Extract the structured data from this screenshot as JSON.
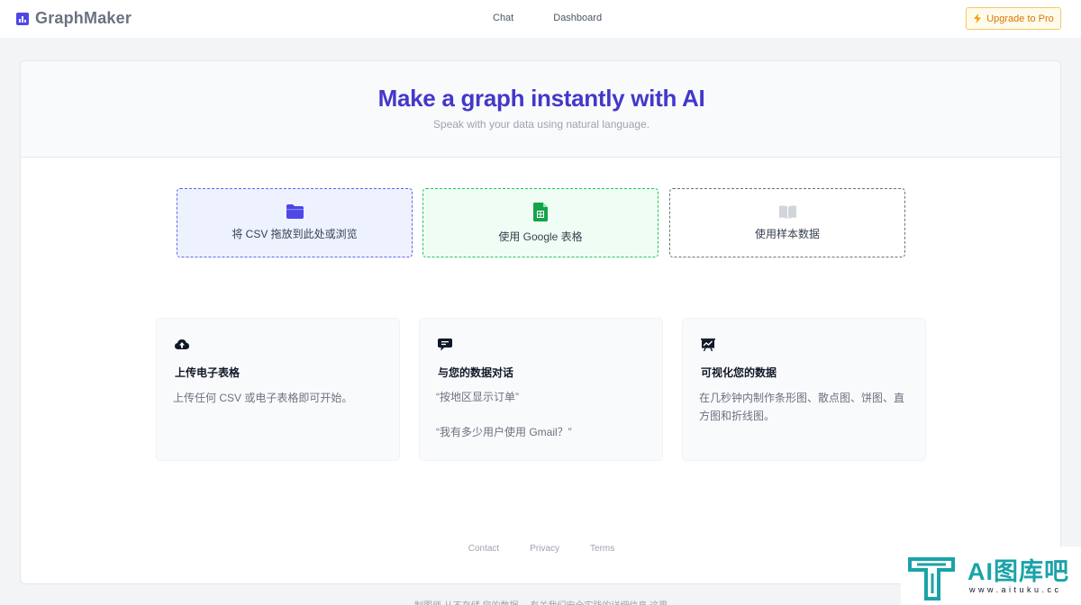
{
  "brand": {
    "name": "GraphMaker",
    "icon": "chart-bar-icon"
  },
  "nav": {
    "items": [
      "Chat",
      "Dashboard"
    ]
  },
  "upgrade": {
    "label": "Upgrade to Pro",
    "icon": "bolt-icon",
    "color": "#d97706"
  },
  "hero": {
    "title": "Make a graph instantly with AI",
    "subtitle": "Speak with your data using natural language."
  },
  "sources": [
    {
      "label": "将 CSV 拖放到此处或浏览",
      "icon": "folder-icon",
      "color": "#4f46e5"
    },
    {
      "label": "使用 Google 表格",
      "icon": "google-sheets-icon",
      "color": "#16a34a"
    },
    {
      "label": "使用样本数据",
      "icon": "book-icon",
      "color": "#9ca3af"
    }
  ],
  "features": [
    {
      "title": "上传电子表格",
      "icon": "cloud-upload-icon",
      "description": "上传任何 CSV 或电子表格即可开始。"
    },
    {
      "title": "与您的数据对话",
      "icon": "chat-icon",
      "quotes": [
        "“按地区显示订单”",
        "“我有多少用户使用 Gmail？”"
      ]
    },
    {
      "title": "可视化您的数据",
      "icon": "presentation-chart-icon",
      "description": "在几秒钟内制作条形图、散点图、饼图、直方图和折线图。"
    }
  ],
  "footer": {
    "links": [
      "Contact",
      "Privacy",
      "Terms"
    ]
  },
  "bottom_note": "制图师 从不存储 您的数据。 有关我们安全实践的详细信息 这里",
  "watermark": {
    "title": "AI图库吧",
    "url": "www.aituku.cc"
  },
  "colors": {
    "accent": "#4338ca",
    "background": "#f3f4f6"
  }
}
